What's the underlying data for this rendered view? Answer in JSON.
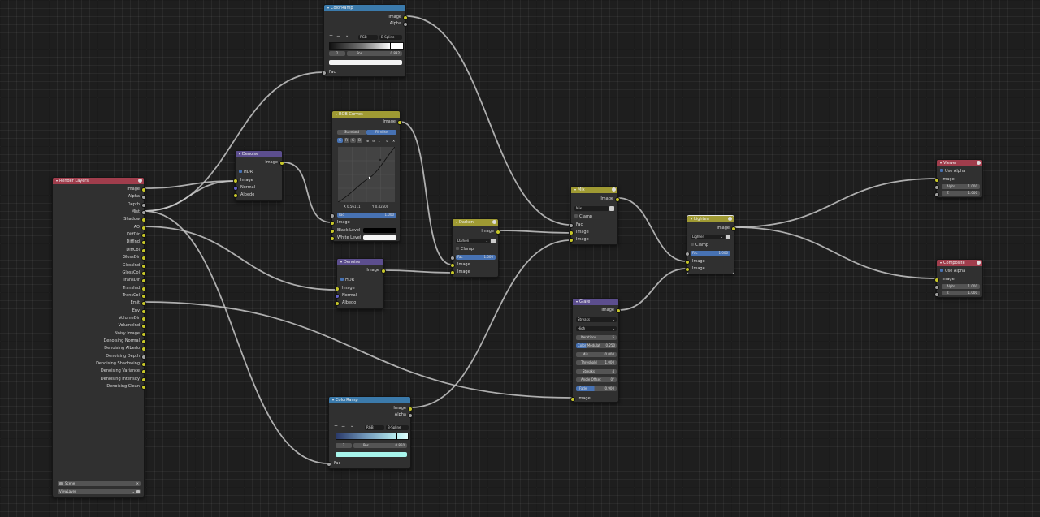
{
  "colors": {
    "input_header": "#a03d4c",
    "converter_header": "#3b7aab",
    "color_header": "#9f9a33",
    "filter_header": "#5c4e8e",
    "output_header": "#a03d4c",
    "link": "#c8c8c8"
  },
  "render_layers": {
    "title": "Render Layers",
    "outputs": [
      "Image",
      "Alpha",
      "Depth",
      "Mist",
      "Shadow",
      "AO",
      "DiffDir",
      "DiffInd",
      "DiffCol",
      "GlossDir",
      "GlossInd",
      "GlossCol",
      "TransDir",
      "TransInd",
      "TransCol",
      "Emit",
      "Env",
      "VolumeDir",
      "VolumeInd",
      "Noisy Image",
      "Denoising Normal",
      "Denoising Albedo",
      "Denoising Depth",
      "Denoising Shadowing",
      "Denoising Variance",
      "Denoising Intensity",
      "Denoising Clean"
    ],
    "scene": "Scene",
    "view_layer": "ViewLayer"
  },
  "colorramp_top": {
    "title": "ColorRamp",
    "out_image": "Image",
    "out_alpha": "Alpha",
    "color_mode": "RGB",
    "interpolation": "B-Spline",
    "stop_index": "2",
    "pos_label": "Pos",
    "pos_value": "0.832",
    "in_fac": "Fac"
  },
  "rgb_curves": {
    "title": "RGB Curves",
    "out_image": "Image",
    "tab_standard": "Standard",
    "tab_filmlike": "Filmlike",
    "channels": [
      "C",
      "R",
      "G",
      "B"
    ],
    "readout_x": "X 0.56111",
    "readout_y": "Y 0.42500",
    "fac_label": "Fac",
    "fac_value": "1.000",
    "in_image": "Image",
    "black_level": "Black Level",
    "white_level": "White Level"
  },
  "denoise_1": {
    "title": "Denoise",
    "out_image": "Image",
    "hdr": "HDR",
    "in_image": "Image",
    "in_normal": "Normal",
    "in_albedo": "Albedo"
  },
  "denoise_2": {
    "title": "Denoise",
    "out_image": "Image",
    "hdr": "HDR",
    "in_image": "Image",
    "in_normal": "Normal",
    "in_albedo": "Albedo"
  },
  "darken": {
    "title": "Darken",
    "out_image": "Image",
    "mode": "Darken",
    "clamp": "Clamp",
    "fac_label": "Fac",
    "fac_value": "1.000",
    "in_image1": "Image",
    "in_image2": "Image"
  },
  "mix": {
    "title": "Mix",
    "out_image": "Image",
    "mode": "Mix",
    "clamp": "Clamp",
    "in_fac": "Fac",
    "in_image1": "Image",
    "in_image2": "Image"
  },
  "lighten": {
    "title": "Lighten",
    "out_image": "Image",
    "mode": "Lighten",
    "clamp": "Clamp",
    "fac_label": "Fac",
    "fac_value": "1.000",
    "in_image1": "Image",
    "in_image2": "Image"
  },
  "glare": {
    "title": "Glare",
    "out_image": "Image",
    "type": "Streaks",
    "quality": "High",
    "iterations_label": "Iterations",
    "iterations_value": "5",
    "color_mod_label": "Color Modulat",
    "color_mod_value": "0.250",
    "mix_label": "Mix",
    "mix_value": "0.000",
    "threshold_label": "Threshold",
    "threshold_value": "1.000",
    "streaks_label": "Streaks",
    "streaks_value": "4",
    "angle_label": "Angle Offset",
    "angle_value": "0°",
    "fade_label": "Fade",
    "fade_value": "0.900",
    "in_image": "Image"
  },
  "colorramp_bottom": {
    "title": "ColorRamp",
    "out_image": "Image",
    "out_alpha": "Alpha",
    "color_mode": "RGB",
    "interpolation": "B-Spline",
    "stop_index": "2",
    "pos_label": "Pos",
    "pos_value": "0.850",
    "in_fac": "Fac"
  },
  "viewer": {
    "title": "Viewer",
    "use_alpha": "Use Alpha",
    "in_image": "Image",
    "alpha_label": "Alpha",
    "alpha_value": "1.000",
    "z_label": "Z",
    "z_value": "1.000"
  },
  "composite": {
    "title": "Composite",
    "use_alpha": "Use Alpha",
    "in_image": "Image",
    "alpha_label": "Alpha",
    "alpha_value": "1.000",
    "z_label": "Z",
    "z_value": "1.000"
  },
  "ramp_buttons": {
    "add": "+",
    "remove": "−",
    "more": "⌄"
  }
}
